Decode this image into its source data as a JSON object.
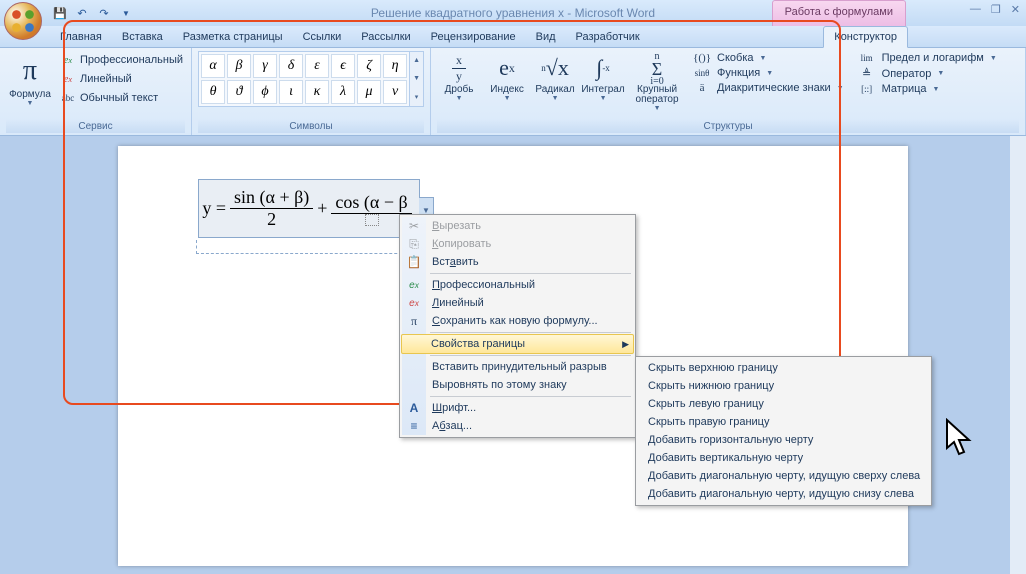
{
  "title": "Решение квадратного уравнения x - Microsoft Word",
  "contextual_title": "Работа с формулами",
  "tabs": {
    "home": "Главная",
    "insert": "Вставка",
    "pagelayout": "Разметка страницы",
    "references": "Ссылки",
    "mailings": "Рассылки",
    "review": "Рецензирование",
    "view": "Вид",
    "developer": "Разработчик",
    "design": "Конструктор"
  },
  "ribbon": {
    "equation": "Формула",
    "professional": "Профессиональный",
    "linear": "Линейный",
    "normaltext": "Обычный текст",
    "tools": "Сервис",
    "symbols": "Символы",
    "fraction": "Дробь",
    "script": "Индекс",
    "radical": "Радикал",
    "integral": "Интеграл",
    "largeop": "Крупный оператор",
    "bracket": "Скобка",
    "function": "Функция",
    "accent": "Диакритические знаки",
    "limit": "Предел и логарифм",
    "operator": "Оператор",
    "matrix": "Матрица",
    "structures": "Структуры"
  },
  "symbols_row1": [
    "α",
    "β",
    "γ",
    "δ",
    "ε",
    "ϵ",
    "ζ",
    "η"
  ],
  "symbols_row2": [
    "θ",
    "ϑ",
    "ϕ",
    "ι",
    "κ",
    "λ",
    "μ",
    "ν"
  ],
  "equation": {
    "lhs": "y =",
    "num1": "sin (α + β)",
    "den1": "2",
    "plus": "+",
    "num2": "cos (α − β",
    "den2": " "
  },
  "ctx": {
    "cut": "Вырезать",
    "copy": "Копировать",
    "paste": "Вставить",
    "professional": "Профессиональный",
    "linear": "Линейный",
    "saveas": "Сохранить как новую формулу...",
    "borderprops": "Свойства границы",
    "insertbreak": "Вставить принудительный разрыв",
    "alignat": "Выровнять по этому знаку",
    "font": "Шрифт...",
    "paragraph": "Абзац..."
  },
  "sub": {
    "hidetop": "Скрыть верхнюю границу",
    "hidebottom": "Скрыть нижнюю границу",
    "hideleft": "Скрыть левую границу",
    "hideright": "Скрыть правую границу",
    "addhstrike": "Добавить горизонтальную черту",
    "addvstrike": "Добавить вертикальную черту",
    "adddiagtl": "Добавить диагональную черту, идущую сверху слева",
    "adddiagbl": "Добавить диагональную черту, идущую снизу слева"
  }
}
